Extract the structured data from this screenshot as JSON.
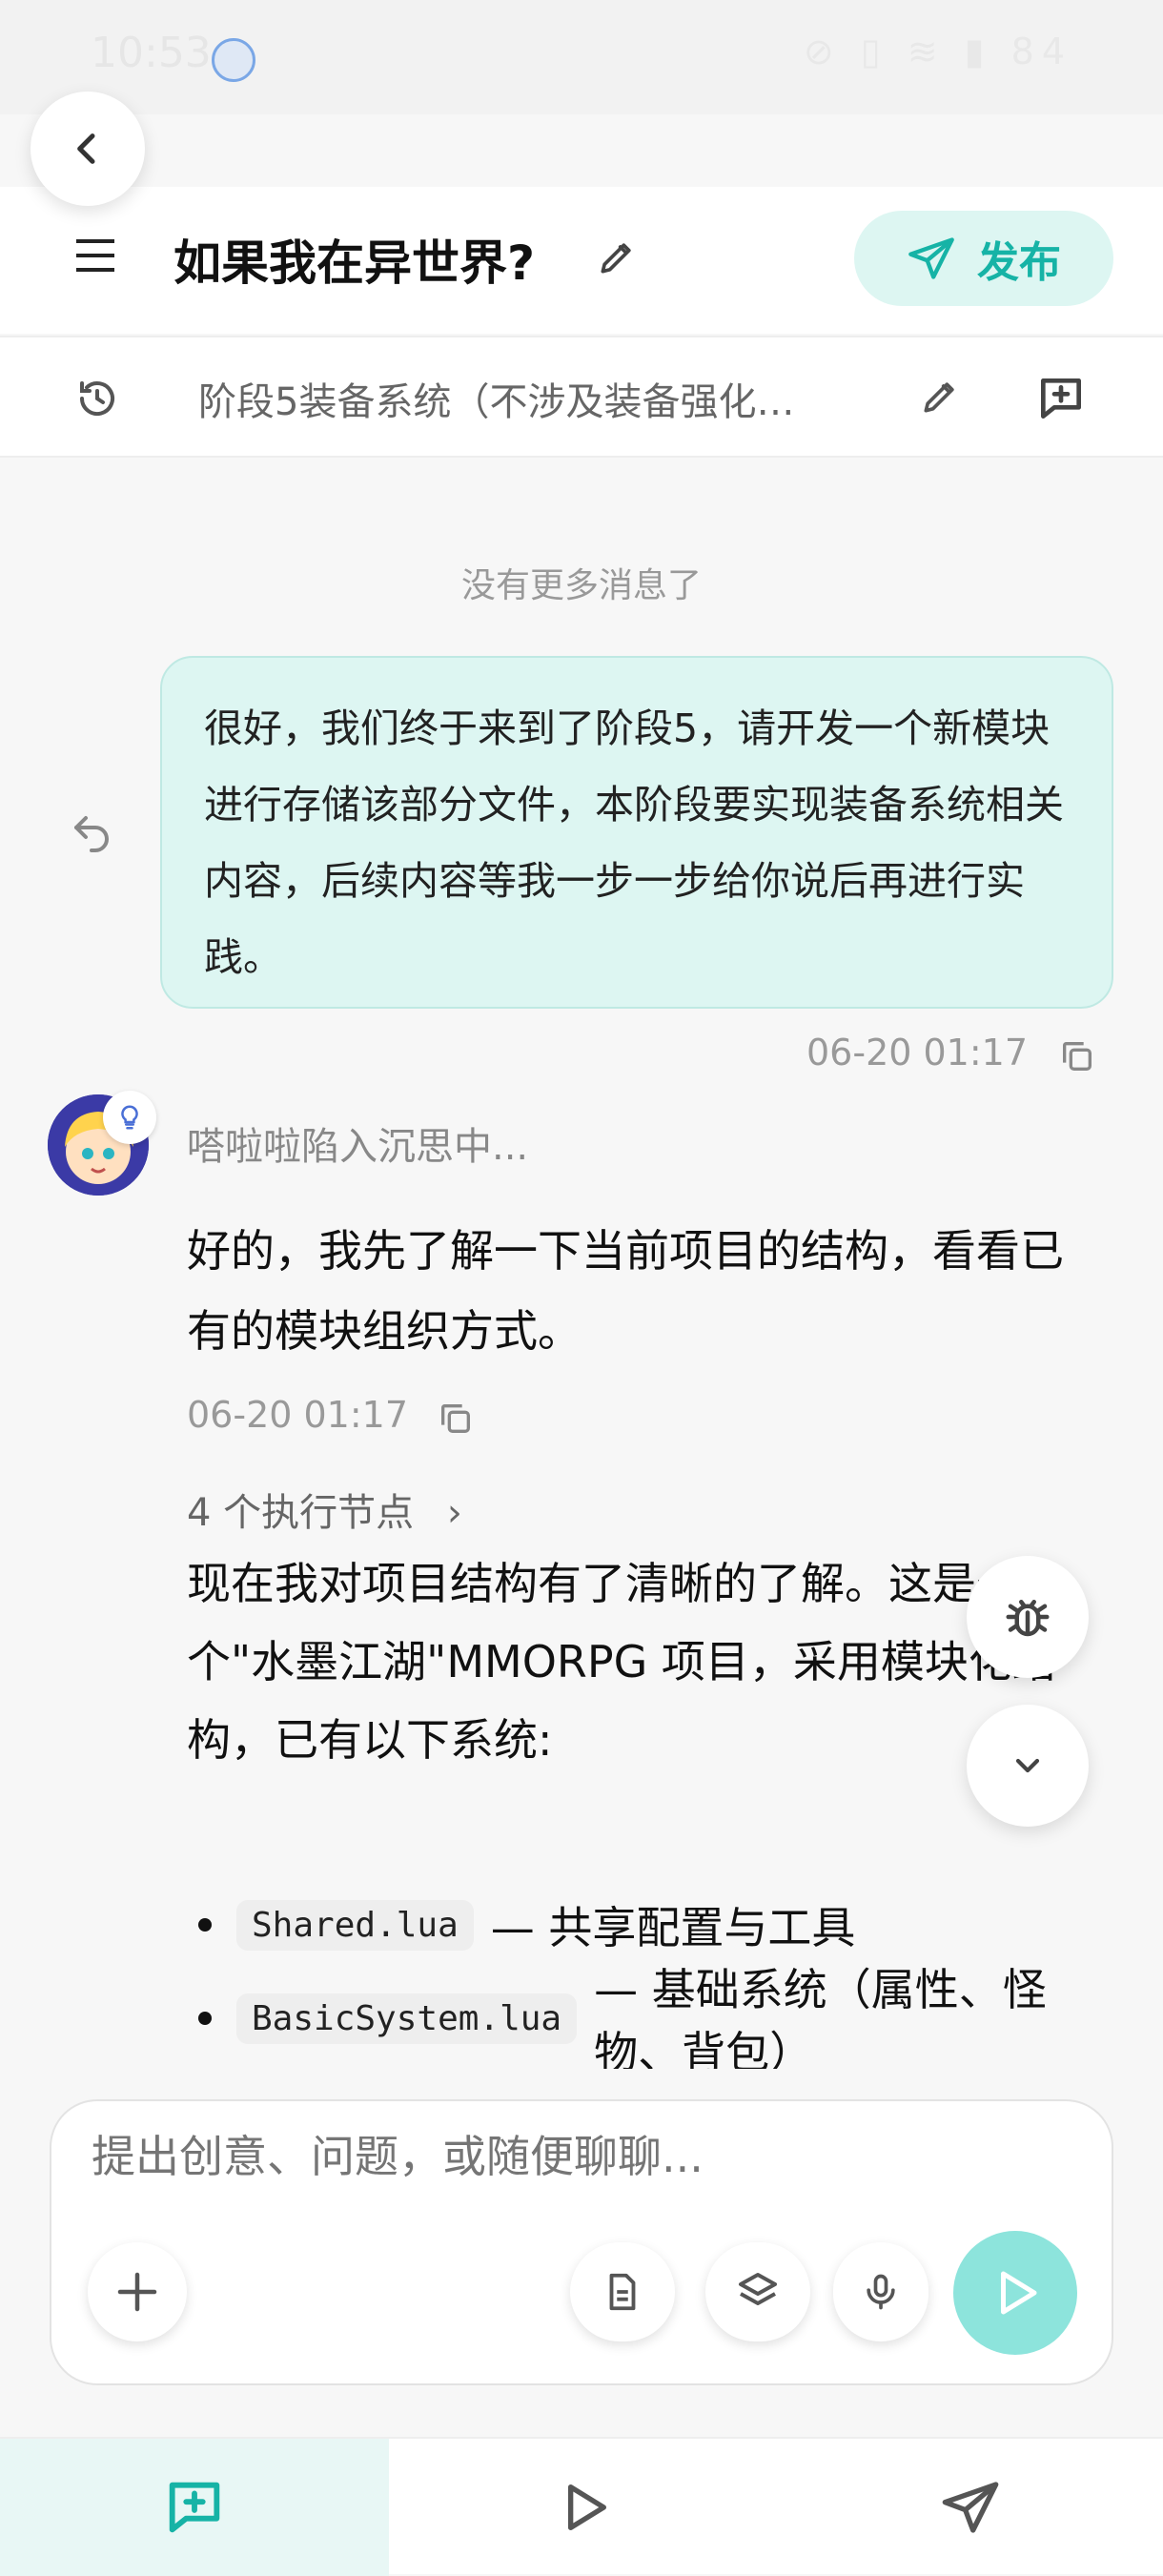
{
  "status_bar": {
    "time": "10:53",
    "indicators": "⊘ ▯ ≋ ▮ 84"
  },
  "header": {
    "title": "如果我在异世界?",
    "publish_label": "发布"
  },
  "stage": {
    "text": "阶段5装备系统（不涉及装备强化…"
  },
  "chat": {
    "no_more": "没有更多消息了",
    "user_message": "很好，我们终于来到了阶段5，请开发一个新模块进行存储该部分文件，本阶段要实现装备系统相关内容，后续内容等我一步一步给你说后再进行实践。",
    "user_time": "06-20 01:17",
    "thinking_label": "嗒啦啦陷入沉思中...",
    "ai_message_1": "好的，我先了解一下当前项目的结构，看看已有的模块组织方式。",
    "ai_time": "06-20 01:17",
    "exec_nodes": "4 个执行节点",
    "ai_message_2": "现在我对项目结构有了清晰的了解。这是一个\"水墨江湖\"MMORPG 项目，采用模块化结构，已有以下系统:",
    "files": [
      {
        "name": "Shared.lua",
        "desc": "— 共享配置与工具"
      },
      {
        "name": "BasicSystem.lua",
        "desc": "— 基础系统（属性、怪物、背包）"
      }
    ]
  },
  "composer": {
    "placeholder": "提出创意、问题，或随便聊聊..."
  },
  "colors": {
    "accent": "#16b3a6",
    "bubble": "#ddf6f2",
    "send": "#8de4dc"
  }
}
